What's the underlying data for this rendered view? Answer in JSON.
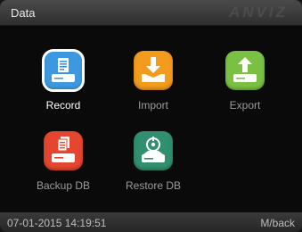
{
  "header": {
    "title": "Data",
    "brand": "ANVIZ"
  },
  "apps": [
    {
      "label": "Record",
      "icon": "record-icon",
      "color": "#3d98df",
      "selected": true
    },
    {
      "label": "Import",
      "icon": "import-icon",
      "color": "#f29b1d",
      "selected": false
    },
    {
      "label": "Export",
      "icon": "export-icon",
      "color": "#7ac143",
      "selected": false
    },
    {
      "label": "Backup DB",
      "icon": "backup-db-icon",
      "color": "#e6452f",
      "selected": false
    },
    {
      "label": "Restore DB",
      "icon": "restore-db-icon",
      "color": "#2f8f6f",
      "selected": false
    }
  ],
  "status": {
    "datetime": "07-01-2015 14:19:51",
    "hint": "M/back"
  }
}
